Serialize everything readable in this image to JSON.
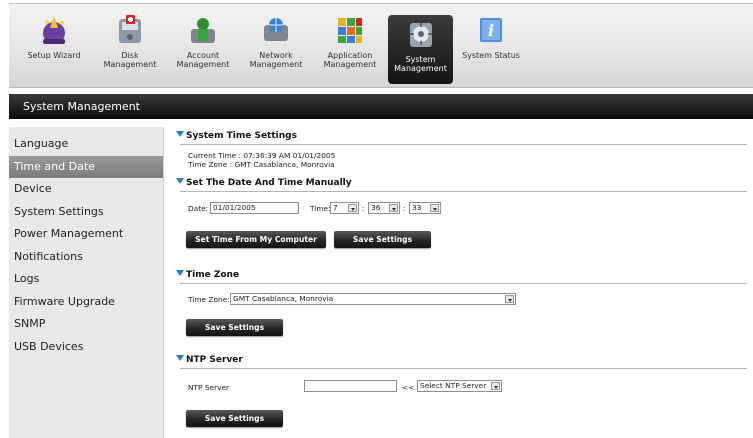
{
  "toolbar": {
    "items": [
      {
        "label": "Setup Wizard",
        "icon": "wizard-icon"
      },
      {
        "label": "Disk\nManagement",
        "icon": "disk-icon"
      },
      {
        "label": "Account\nManagement",
        "icon": "account-icon"
      },
      {
        "label": "Network\nManagement",
        "icon": "network-icon"
      },
      {
        "label": "Application\nManagement",
        "icon": "application-icon"
      },
      {
        "label": "System\nManagement",
        "icon": "system-icon"
      },
      {
        "label": "System Status",
        "icon": "info-icon"
      }
    ],
    "active_index": 5
  },
  "section_bar": {
    "title": "System Management"
  },
  "sidebar": {
    "items": [
      {
        "label": "Language"
      },
      {
        "label": "Time and Date"
      },
      {
        "label": "Device"
      },
      {
        "label": "System Settings"
      },
      {
        "label": "Power Management"
      },
      {
        "label": "Notifications"
      },
      {
        "label": "Logs"
      },
      {
        "label": "Firmware Upgrade"
      },
      {
        "label": "SNMP"
      },
      {
        "label": "USB Devices"
      }
    ],
    "active_index": 1
  },
  "system_time": {
    "title": "System Time Settings",
    "current_time": "Current Time : 07:36:39 AM 01/01/2005",
    "time_zone": "Time Zone : GMT Casablanca, Monrovia"
  },
  "manual": {
    "title": "Set The Date And Time Manually",
    "date_label": "Date:",
    "date_value": "01/01/2005",
    "time_label": "Time:",
    "hour": "7",
    "minute": "36",
    "second": "33",
    "colon": ":",
    "set_time_button": "Set Time From My Computer",
    "save_button": "Save Settings"
  },
  "timezone": {
    "title": "Time Zone",
    "label": "Time Zone:",
    "value": "GMT Casablanca, Monrovia",
    "save_button": "Save Settings"
  },
  "ntp": {
    "title": "NTP Server",
    "label": "NTP Server",
    "value": "",
    "arrows": "<<",
    "select_value": "Select NTP Server",
    "save_button": "Save Settings"
  },
  "colors": {
    "accent": "#1e7fd6",
    "active_tool_bg": "#1a1a1a",
    "sidebar_bg": "#e9e9e9"
  }
}
